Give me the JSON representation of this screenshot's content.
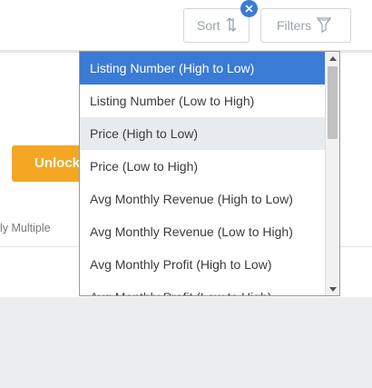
{
  "toolbar": {
    "sort_label": "Sort",
    "filters_label": "Filters"
  },
  "card": {
    "unlock_label": "Unlock",
    "multiple_label": "ly Multiple"
  },
  "dropdown": {
    "options": [
      {
        "label": "Listing Number (High to Low)",
        "state": "selected"
      },
      {
        "label": "Listing Number (Low to High)",
        "state": "normal"
      },
      {
        "label": "Price (High to Low)",
        "state": "hover"
      },
      {
        "label": "Price (Low to High)",
        "state": "normal"
      },
      {
        "label": "Avg Monthly Revenue (High to Low)",
        "state": "normal"
      },
      {
        "label": "Avg Monthly Revenue (Low to High)",
        "state": "normal"
      },
      {
        "label": "Avg Monthly Profit (High to Low)",
        "state": "normal"
      },
      {
        "label": "Avg Monthly Profit (Low to High)",
        "state": "normal"
      }
    ]
  },
  "colors": {
    "accent": "#3a7bd5",
    "unlock": "#f5a623",
    "hover": "#e8ebee"
  }
}
